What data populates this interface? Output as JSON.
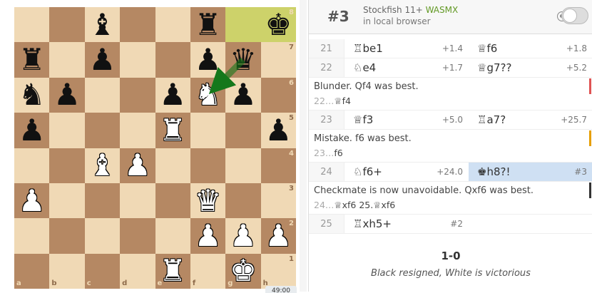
{
  "board": {
    "files": [
      "a",
      "b",
      "c",
      "d",
      "e",
      "f",
      "g",
      "h"
    ],
    "ranks": [
      "8",
      "7",
      "6",
      "5",
      "4",
      "3",
      "2",
      "1"
    ],
    "highlight": [
      "g8",
      "h8"
    ],
    "pieces": [
      {
        "sq": "c8",
        "glyph": "♝",
        "color": "b",
        "name": "black-bishop"
      },
      {
        "sq": "f8",
        "glyph": "♜",
        "color": "b",
        "name": "black-rook"
      },
      {
        "sq": "h8",
        "glyph": "♚",
        "color": "b",
        "name": "black-king"
      },
      {
        "sq": "a7",
        "glyph": "♜",
        "color": "b",
        "name": "black-rook"
      },
      {
        "sq": "c7",
        "glyph": "♟",
        "color": "b",
        "name": "black-pawn"
      },
      {
        "sq": "f7",
        "glyph": "♟",
        "color": "b",
        "name": "black-pawn"
      },
      {
        "sq": "g7",
        "glyph": "♛",
        "color": "b",
        "name": "black-queen"
      },
      {
        "sq": "a6",
        "glyph": "♞",
        "color": "b",
        "name": "black-knight"
      },
      {
        "sq": "b6",
        "glyph": "♟",
        "color": "b",
        "name": "black-pawn"
      },
      {
        "sq": "e6",
        "glyph": "♟",
        "color": "b",
        "name": "black-pawn"
      },
      {
        "sq": "f6",
        "glyph": "♞",
        "color": "w",
        "name": "white-knight"
      },
      {
        "sq": "g6",
        "glyph": "♟",
        "color": "b",
        "name": "black-pawn"
      },
      {
        "sq": "a5",
        "glyph": "♟",
        "color": "b",
        "name": "black-pawn"
      },
      {
        "sq": "e5",
        "glyph": "♜",
        "color": "w",
        "name": "white-rook"
      },
      {
        "sq": "h5",
        "glyph": "♟",
        "color": "b",
        "name": "black-pawn"
      },
      {
        "sq": "c4",
        "glyph": "♝",
        "color": "w",
        "name": "white-bishop"
      },
      {
        "sq": "d4",
        "glyph": "♟",
        "color": "w",
        "name": "white-pawn"
      },
      {
        "sq": "a3",
        "glyph": "♟",
        "color": "w",
        "name": "white-pawn"
      },
      {
        "sq": "f3",
        "glyph": "♛",
        "color": "w",
        "name": "white-queen"
      },
      {
        "sq": "f2",
        "glyph": "♟",
        "color": "w",
        "name": "white-pawn"
      },
      {
        "sq": "g2",
        "glyph": "♟",
        "color": "w",
        "name": "white-pawn"
      },
      {
        "sq": "h2",
        "glyph": "♟",
        "color": "w",
        "name": "white-pawn"
      },
      {
        "sq": "e1",
        "glyph": "♜",
        "color": "w",
        "name": "white-rook"
      },
      {
        "sq": "g1",
        "glyph": "♚",
        "color": "w",
        "name": "white-king"
      }
    ],
    "arrow": {
      "from": "g7",
      "to": "f6",
      "color": "#15781b"
    },
    "clock_stub": "49:00"
  },
  "ceval": {
    "score": "#3",
    "engine_name": "Stockfish 11+",
    "engine_tag": "WASMX",
    "location": "in local browser"
  },
  "moves": {
    "row21": {
      "num": "21",
      "white": "♖be1",
      "white_eval": "+1.4",
      "black": "♕f6",
      "black_eval": "+1.8"
    },
    "row22": {
      "num": "22",
      "white": "♘e4",
      "white_eval": "+1.7",
      "black": "♕g7",
      "black_glyph": "??",
      "black_eval": "+5.2"
    },
    "comment22": {
      "text": "Blunder. Qf4 was best.",
      "alt_pre": "22…",
      "alt": "♕f4",
      "bar_color": "#df5353"
    },
    "row23": {
      "num": "23",
      "white": "♕f3",
      "white_eval": "+5.0",
      "black": "♖a7",
      "black_glyph": "?",
      "black_eval": "+25.7"
    },
    "comment23": {
      "text": "Mistake. f6 was best.",
      "alt_pre": "23…",
      "alt": "f6",
      "bar_color": "#e69f00"
    },
    "row24": {
      "num": "24",
      "white": "♘f6+",
      "white_eval": "+24.0",
      "black": "♚h8",
      "black_glyph": "?!",
      "black_eval": "#3"
    },
    "comment24": {
      "text": "Checkmate is now unavoidable. Qxf6 was best.",
      "alt_pre": "24…",
      "alt": "♕xf6 25.♕xf6",
      "bar_color": "#56b4e9"
    },
    "row25": {
      "num": "25",
      "white": "♖xh5+",
      "white_eval": "#2"
    }
  },
  "result": {
    "score": "1-0",
    "status": "Black resigned, White is victorious"
  }
}
